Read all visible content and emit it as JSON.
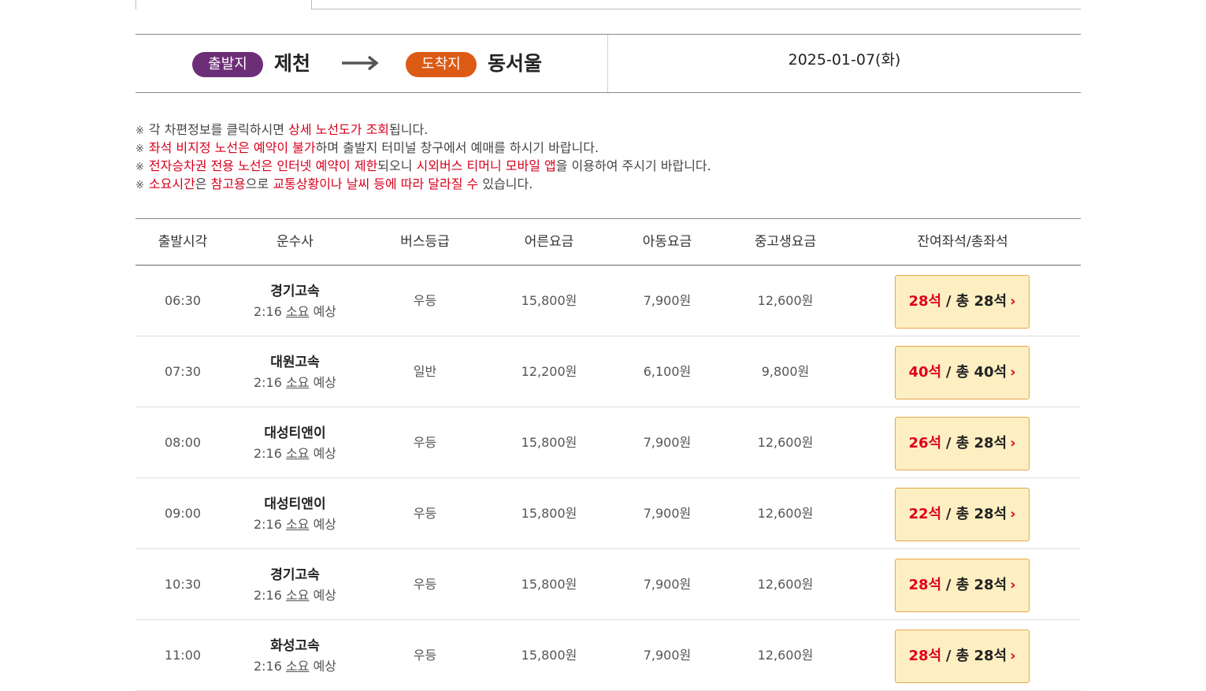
{
  "route": {
    "departure_label": "출발지",
    "departure_city": "제천",
    "arrival_label": "도착지",
    "arrival_city": "동서울",
    "date": "2025-01-07(화)",
    "colors": {
      "departure_pill": "#6d2e78",
      "arrival_pill": "#dd5a14",
      "highlight": "#d8001c"
    }
  },
  "notices": [
    {
      "mark": "※",
      "parts": [
        {
          "t": "각 차편정보를 클릭하시면 ",
          "hl": false
        },
        {
          "t": "상세 노선도가 조회",
          "hl": true
        },
        {
          "t": "됩니다.",
          "hl": false
        }
      ]
    },
    {
      "mark": "※",
      "parts": [
        {
          "t": "좌석 비지정 노선은 예약이 불가",
          "hl": true
        },
        {
          "t": "하며 출발지 터미널 창구에서 예매를 하시기 바랍니다.",
          "hl": false
        }
      ]
    },
    {
      "mark": "※",
      "parts": [
        {
          "t": "전자승차권 전용 노선은 인터넷 예약이 제한",
          "hl": true
        },
        {
          "t": "되오니 ",
          "hl": false
        },
        {
          "t": "시외버스 티머니 모바일 앱",
          "hl": true
        },
        {
          "t": "을 이용하여 주시기 바랍니다.",
          "hl": false
        }
      ]
    },
    {
      "mark": "※",
      "parts": [
        {
          "t": "소요시간",
          "hl": true
        },
        {
          "t": "은 ",
          "hl": false
        },
        {
          "t": "참고용",
          "hl": true
        },
        {
          "t": "으로 ",
          "hl": false
        },
        {
          "t": "교통상황이나 날씨 등에 따라 달라질 수",
          "hl": true
        },
        {
          "t": " 있습니다.",
          "hl": false
        }
      ]
    }
  ],
  "table": {
    "headers": [
      "출발시각",
      "운수사",
      "버스등급",
      "어른요금",
      "아동요금",
      "중고생요금",
      "잔여좌석/총좌석"
    ],
    "rows": [
      {
        "time": "06:30",
        "company": "경기고속",
        "dur_time": "2:16",
        "dur_word1": "소요",
        "dur_word2": "예상",
        "grade": "우등",
        "adult": "15,800원",
        "child": "7,900원",
        "teen": "12,600원",
        "remain": "28석",
        "total": "/ 총 28석"
      },
      {
        "time": "07:30",
        "company": "대원고속",
        "dur_time": "2:16",
        "dur_word1": "소요",
        "dur_word2": "예상",
        "grade": "일반",
        "adult": "12,200원",
        "child": "6,100원",
        "teen": "9,800원",
        "remain": "40석",
        "total": "/ 총 40석"
      },
      {
        "time": "08:00",
        "company": "대성티앤이",
        "dur_time": "2:16",
        "dur_word1": "소요",
        "dur_word2": "예상",
        "grade": "우등",
        "adult": "15,800원",
        "child": "7,900원",
        "teen": "12,600원",
        "remain": "26석",
        "total": "/ 총 28석"
      },
      {
        "time": "09:00",
        "company": "대성티앤이",
        "dur_time": "2:16",
        "dur_word1": "소요",
        "dur_word2": "예상",
        "grade": "우등",
        "adult": "15,800원",
        "child": "7,900원",
        "teen": "12,600원",
        "remain": "22석",
        "total": "/ 총 28석"
      },
      {
        "time": "10:30",
        "company": "경기고속",
        "dur_time": "2:16",
        "dur_word1": "소요",
        "dur_word2": "예상",
        "grade": "우등",
        "adult": "15,800원",
        "child": "7,900원",
        "teen": "12,600원",
        "remain": "28석",
        "total": "/ 총 28석"
      },
      {
        "time": "11:00",
        "company": "화성고속",
        "dur_time": "2:16",
        "dur_word1": "소요",
        "dur_word2": "예상",
        "grade": "우등",
        "adult": "15,800원",
        "child": "7,900원",
        "teen": "12,600원",
        "remain": "28석",
        "total": "/ 총 28석"
      }
    ],
    "seat_button_chevron": "›"
  }
}
